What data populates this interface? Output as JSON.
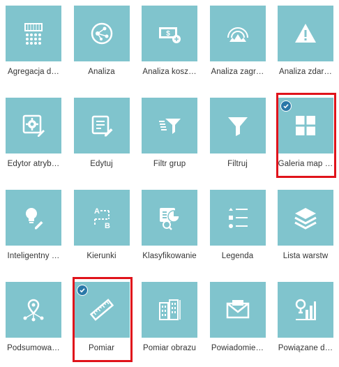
{
  "widgets": [
    {
      "label": "Agregacja d…",
      "icon": "aggregate-icon",
      "selected": false
    },
    {
      "label": "Analiza",
      "icon": "network-analysis-icon",
      "selected": false
    },
    {
      "label": "Analiza kosz…",
      "icon": "cost-money-icon",
      "selected": false
    },
    {
      "label": "Analiza zagr…",
      "icon": "threat-radar-icon",
      "selected": false
    },
    {
      "label": "Analiza zdar…",
      "icon": "warning-icon",
      "selected": false
    },
    {
      "label": "Edytor atryb…",
      "icon": "attribute-editor-icon",
      "selected": false
    },
    {
      "label": "Edytuj",
      "icon": "edit-list-icon",
      "selected": false
    },
    {
      "label": "Filtr grup",
      "icon": "group-filter-icon",
      "selected": false
    },
    {
      "label": "Filtruj",
      "icon": "filter-icon",
      "selected": false
    },
    {
      "label": "Galeria map …",
      "icon": "gallery-grid-icon",
      "selected": true
    },
    {
      "label": "Inteligentny …",
      "icon": "smart-editor-icon",
      "selected": false
    },
    {
      "label": "Kierunki",
      "icon": "directions-icon",
      "selected": false
    },
    {
      "label": "Klasyfikowanie",
      "icon": "classify-chart-icon",
      "selected": false
    },
    {
      "label": "Legenda",
      "icon": "legend-icon",
      "selected": false
    },
    {
      "label": "Lista warstw",
      "icon": "layers-icon",
      "selected": false
    },
    {
      "label": "Podsumowa…",
      "icon": "summary-location-icon",
      "selected": false
    },
    {
      "label": "Pomiar",
      "icon": "ruler-icon",
      "selected": true
    },
    {
      "label": "Pomiar obrazu",
      "icon": "building-measure-icon",
      "selected": false
    },
    {
      "label": "Powiadomie…",
      "icon": "notification-envelope-icon",
      "selected": false
    },
    {
      "label": "Powiązane d…",
      "icon": "related-data-icon",
      "selected": false
    }
  ],
  "colors": {
    "tile": "#80c4cd",
    "selection_frame": "#e0131b",
    "check_badge": "#2a78a8"
  }
}
